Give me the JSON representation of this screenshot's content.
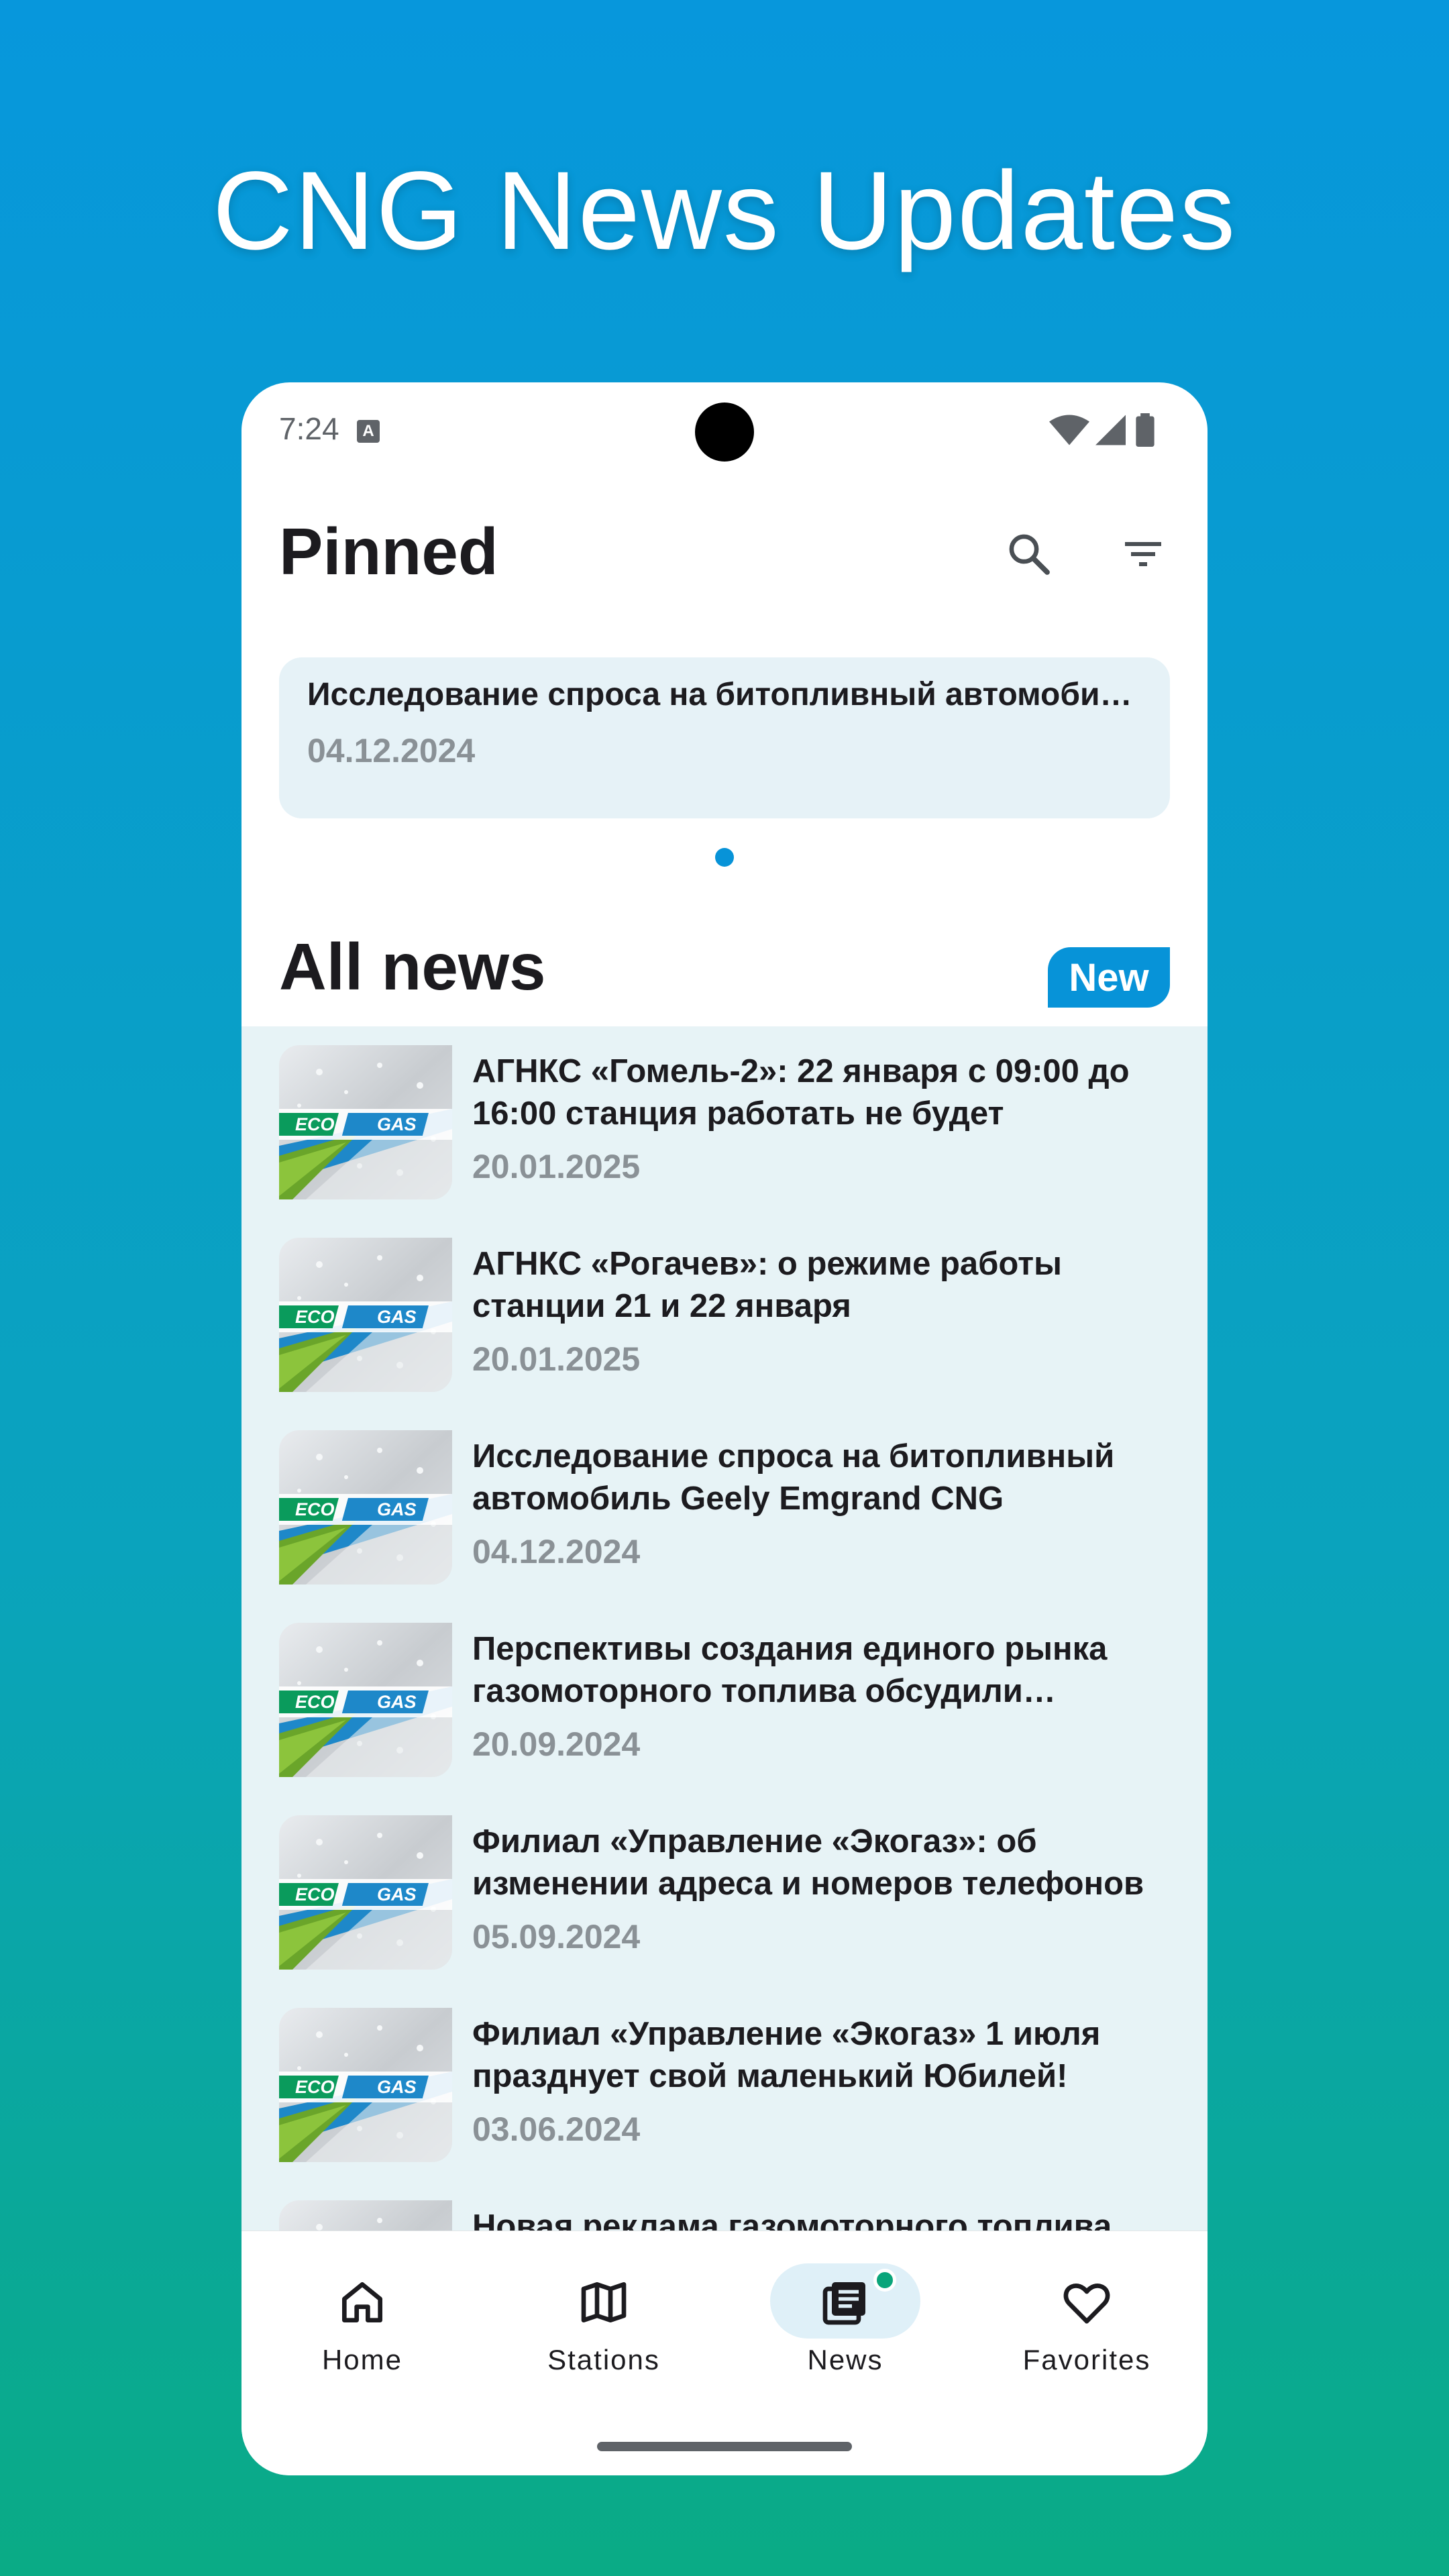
{
  "promo": {
    "title": "CNG News Updates"
  },
  "status_bar": {
    "time": "7:24",
    "notification_icon": "text-a-icon",
    "icons": [
      "wifi-icon",
      "signal-icon",
      "battery-icon"
    ]
  },
  "header": {
    "title": "Pinned",
    "search_icon": "search-icon",
    "filter_icon": "filter-icon"
  },
  "pinned": {
    "items": [
      {
        "title": "Исследование спроса на битопливный автомобиль Geely Emgrand CNG",
        "date": "04.12.2024"
      }
    ],
    "page_count": 1,
    "active_page": 1
  },
  "all_news": {
    "title": "All news",
    "badge": "New",
    "thumb_logo": {
      "eco": "ECO",
      "gas": "GAS"
    },
    "items": [
      {
        "title": "АГНКС «Гомель-2»: 22 января с 09:00 до 16:00 станция работать не будет",
        "date": "20.01.2025"
      },
      {
        "title": "АГНКС «Рогачев»: о режиме работы станции 21 и 22 января",
        "date": "20.01.2025"
      },
      {
        "title": "Исследование спроса на битопливный автомобиль Geely Emgrand CNG",
        "date": "04.12.2024"
      },
      {
        "title": "Перспективы создания единого рынка газомоторного топлива обсудили союзные государства",
        "date": "20.09.2024"
      },
      {
        "title": "Филиал «Управление «Экогаз»: об изменении адреса и номеров телефонов",
        "date": "05.09.2024"
      },
      {
        "title": "Филиал «Управление «Экогаз» 1 июля празднует свой маленький Юбилей!",
        "date": "03.06.2024"
      },
      {
        "title": "Новая реклама газомоторного топлива",
        "date": ""
      }
    ]
  },
  "nav": {
    "items": [
      {
        "label": "Home",
        "icon": "home-icon"
      },
      {
        "label": "Stations",
        "icon": "map-icon"
      },
      {
        "label": "News",
        "icon": "news-icon",
        "active": true,
        "badge_dot": true
      },
      {
        "label": "Favorites",
        "icon": "heart-icon"
      }
    ]
  },
  "colors": {
    "accent": "#0793d8",
    "badge_dot": "#0aa57a",
    "list_bg": "#e7f3f6",
    "date_gray": "#8a9196"
  }
}
